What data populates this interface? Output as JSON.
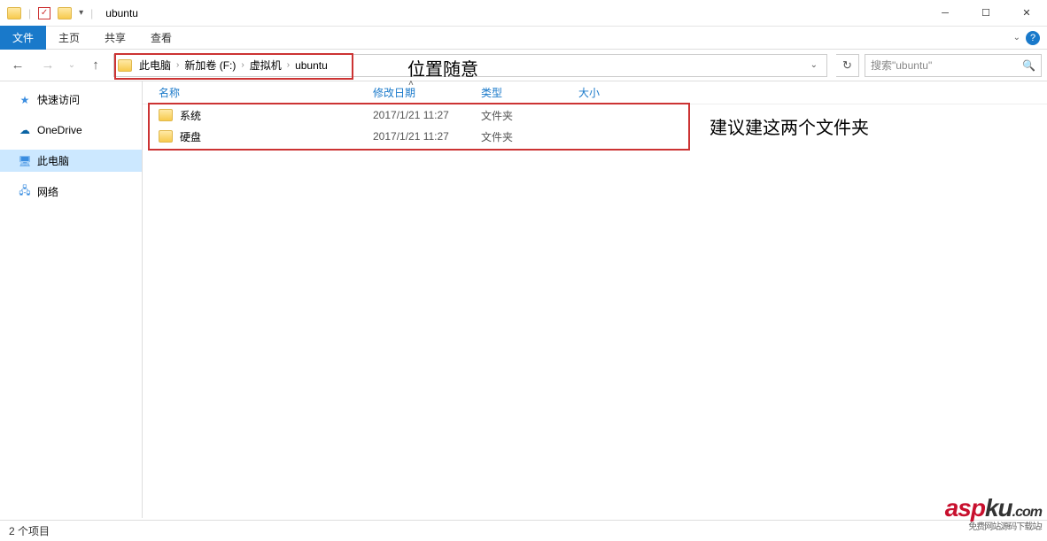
{
  "window": {
    "title": "ubuntu"
  },
  "ribbon": {
    "file": "文件",
    "tabs": [
      "主页",
      "共享",
      "查看"
    ]
  },
  "breadcrumb": {
    "parts": [
      "此电脑",
      "新加卷 (F:)",
      "虚拟机",
      "ubuntu"
    ]
  },
  "search": {
    "placeholder": "搜索\"ubuntu\""
  },
  "sidebar": {
    "quick_access": "快速访问",
    "onedrive": "OneDrive",
    "this_pc": "此电脑",
    "network": "网络"
  },
  "columns": {
    "name": "名称",
    "date": "修改日期",
    "type": "类型",
    "size": "大小"
  },
  "files": [
    {
      "name": "系统",
      "date": "2017/1/21 11:27",
      "type": "文件夹"
    },
    {
      "name": "硬盘",
      "date": "2017/1/21 11:27",
      "type": "文件夹"
    }
  ],
  "annotations": {
    "position": "位置随意",
    "suggest": "建议建这两个文件夹"
  },
  "status": {
    "count": "2 个项目"
  },
  "watermark": {
    "asp": "asp",
    "ku": "ku",
    "com": ".com",
    "sub": "免费网站源码下载站!"
  }
}
